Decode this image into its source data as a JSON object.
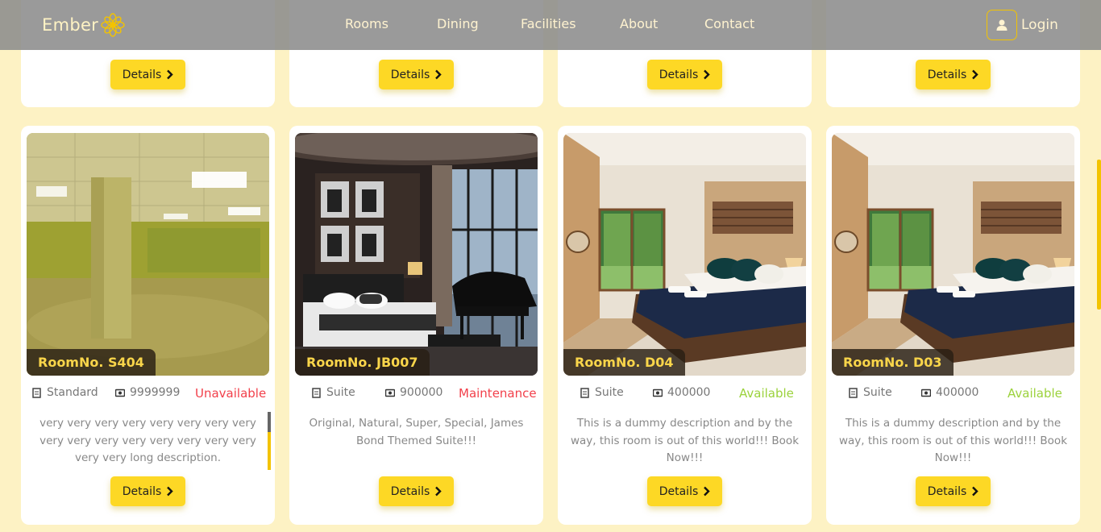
{
  "brand": {
    "name": "Ember"
  },
  "nav": {
    "links": [
      "Rooms",
      "Dining",
      "Facilities",
      "About",
      "Contact"
    ],
    "login": "Login"
  },
  "details_label": "Details",
  "rooms": [
    {
      "label": "RoomNo. S404",
      "type": "Standard",
      "price": "9999999",
      "status": "Unavailable",
      "description": "very very very very very very very very very very very very very very very very very very long description.",
      "image": "empty-hall"
    },
    {
      "label": "RoomNo. JB007",
      "type": "Suite",
      "price": "900000",
      "status": "Maintenance",
      "description": "Original, Natural, Super, Special, James Bond Themed Suite!!!",
      "image": "luxury-suite-piano"
    },
    {
      "label": "RoomNo. D04",
      "type": "Suite",
      "price": "400000",
      "status": "Available",
      "description": "This is a dummy description and by the way, this room is out of this world!!! Book Now!!!",
      "image": "bedroom-garden"
    },
    {
      "label": "RoomNo. D03",
      "type": "Suite",
      "price": "400000",
      "status": "Available",
      "description": "This is a dummy description and by the way, this room is out of this world!!! Book Now!!!",
      "image": "bedroom-garden"
    }
  ],
  "colors": {
    "accent": "#fdd825",
    "background": "#fdf2c4",
    "unavailable": "#f2404b",
    "maintenance": "#f2404b",
    "available": "#9bd23c"
  }
}
